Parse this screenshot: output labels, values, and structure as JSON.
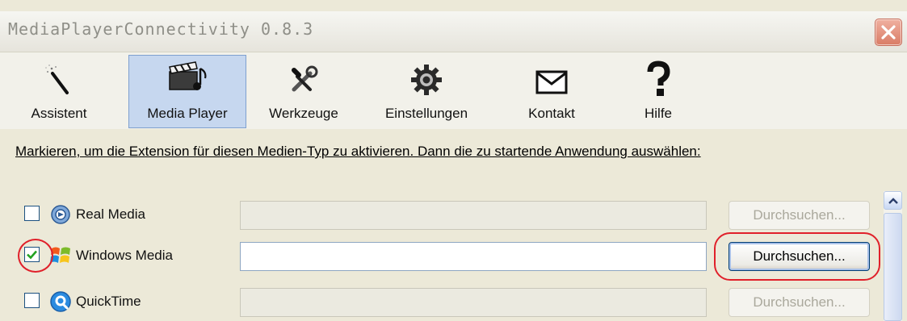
{
  "window": {
    "title": "MediaPlayerConnectivity 0.8.3"
  },
  "toolbar": {
    "items": [
      {
        "label": "Assistent",
        "icon": "magic-wand-icon",
        "selected": false
      },
      {
        "label": "Media Player",
        "icon": "media-player-icon",
        "selected": true
      },
      {
        "label": "Werkzeuge",
        "icon": "tools-icon",
        "selected": false
      },
      {
        "label": "Einstellungen",
        "icon": "gear-icon",
        "selected": false
      },
      {
        "label": "Kontakt",
        "icon": "envelope-icon",
        "selected": false
      },
      {
        "label": "Hilfe",
        "icon": "question-icon",
        "selected": false
      }
    ]
  },
  "instruction": "Markieren, um die Extension für diesen Medien-Typ zu aktivieren. Dann die zu startende Anwendung auswählen:",
  "media": [
    {
      "name": "Real Media",
      "icon": "realplayer-icon",
      "checked": false,
      "path": "",
      "browse_label": "Durchsuchen...",
      "enabled": false
    },
    {
      "name": "Windows Media",
      "icon": "windows-media-icon",
      "checked": true,
      "path": "",
      "browse_label": "Durchsuchen...",
      "enabled": true
    },
    {
      "name": "QuickTime",
      "icon": "quicktime-icon",
      "checked": false,
      "path": "",
      "browse_label": "Durchsuchen...",
      "enabled": false
    }
  ],
  "colors": {
    "highlight": "#e0202a",
    "selected_tab": "#c6d7ef",
    "window_bg": "#ece9d8"
  }
}
